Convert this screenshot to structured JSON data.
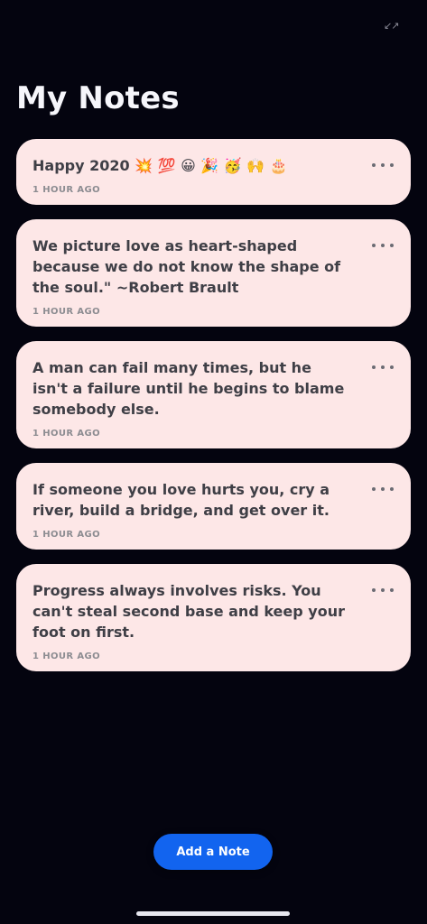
{
  "app": {
    "title": "My Notes",
    "status_glyph": "↙↗"
  },
  "notes": [
    {
      "text": "Happy 2020 💥 💯 😀 🎉 🥳 🙌 🎂",
      "time": "1 HOUR AGO"
    },
    {
      "text": "We picture love as heart-shaped because we do not know the shape of the soul.\" ~Robert Brault",
      "time": "1 HOUR AGO"
    },
    {
      "text": "A man can fail many times, but he isn't a failure until he begins to blame somebody else.",
      "time": "1 HOUR AGO"
    },
    {
      "text": "If someone you love hurts you, cry a river, build a bridge, and get over it.",
      "time": "1 HOUR AGO"
    },
    {
      "text": "Progress always involves risks. You can't steal second base and keep your foot on first.",
      "time": "1 HOUR AGO"
    }
  ],
  "actions": {
    "add_note": "Add a Note"
  },
  "colors": {
    "background": "#04040f",
    "card": "#fde7e7",
    "primary": "#1264ef",
    "title": "#f6f6fb"
  },
  "icons": {
    "card_menu": "ellipsis-horizontal-icon",
    "top_indicator": "status-indicator-icon"
  }
}
